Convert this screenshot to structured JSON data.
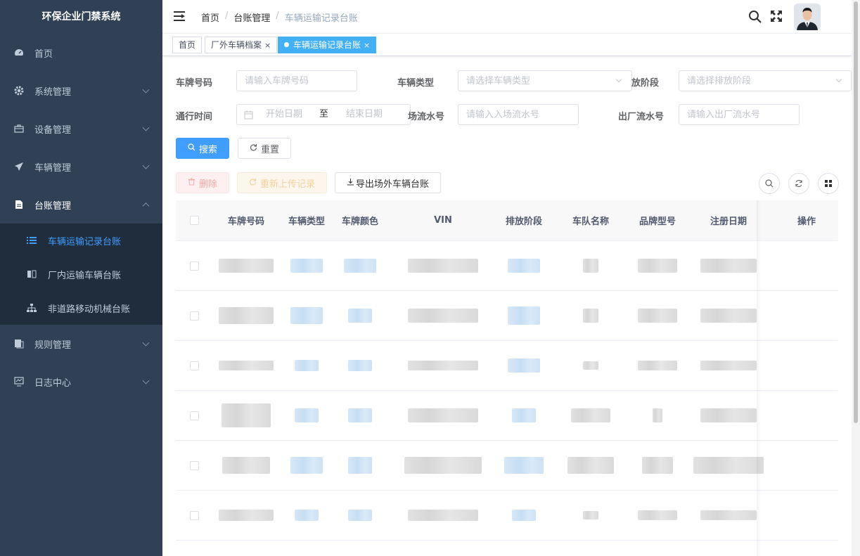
{
  "sidebar": {
    "app_title": "环保企业门禁系统",
    "items": [
      {
        "label": "首页",
        "icon": "dashboard-icon"
      },
      {
        "label": "系统管理",
        "icon": "gear-icon"
      },
      {
        "label": "设备管理",
        "icon": "briefcase-icon"
      },
      {
        "label": "车辆管理",
        "icon": "send-icon"
      },
      {
        "label": "台账管理",
        "icon": "document-icon"
      },
      {
        "label": "规则管理",
        "icon": "stack-icon"
      },
      {
        "label": "日志中心",
        "icon": "monitor-icon"
      }
    ],
    "submenu": [
      {
        "label": "车辆运输记录台账",
        "icon": "list-icon",
        "active": true
      },
      {
        "label": "厂内运输车辆台账",
        "icon": "book-icon",
        "active": false
      },
      {
        "label": "非道路移动机械台账",
        "icon": "tree-icon",
        "active": false
      }
    ]
  },
  "header": {
    "breadcrumb": [
      "首页",
      "台账管理",
      "车辆运输记录台账"
    ],
    "separator": "/"
  },
  "tags": [
    {
      "label": "首页",
      "active": false
    },
    {
      "label": "厂外车辆档案",
      "active": false,
      "close": "×"
    },
    {
      "label": "车辆运输记录台账",
      "active": true,
      "close": "×"
    }
  ],
  "search": {
    "plate_label": "车牌号码",
    "plate_placeholder": "请输入车牌号码",
    "type_label": "车辆类型",
    "type_placeholder": "请选择车辆类型",
    "emission_label": "放阶段",
    "emission_placeholder": "请选择排放阶段",
    "time_label": "通行时间",
    "start_placeholder": "开始日期",
    "range_sep": "至",
    "end_placeholder": "结束日期",
    "in_label": "场流水号",
    "in_placeholder": "请输入入场流水号",
    "out_label": "出厂流水号",
    "out_placeholder": "请输入出厂流水号",
    "search_btn": "搜索",
    "reset_btn": "重置"
  },
  "toolbar": {
    "delete_btn": "删除",
    "reupload_btn": "重新上传记录",
    "export_btn": "导出场外车辆台账"
  },
  "table": {
    "columns": [
      "车牌号码",
      "车辆类型",
      "车牌颜色",
      "VIN",
      "排放阶段",
      "车队名称",
      "品牌型号",
      "注册日期",
      "操作"
    ]
  },
  "colors": {
    "sidebar_bg": "#304156",
    "submenu_bg": "#1f2d3d",
    "accent": "#409eff",
    "active_tag": "#42b0f5"
  }
}
